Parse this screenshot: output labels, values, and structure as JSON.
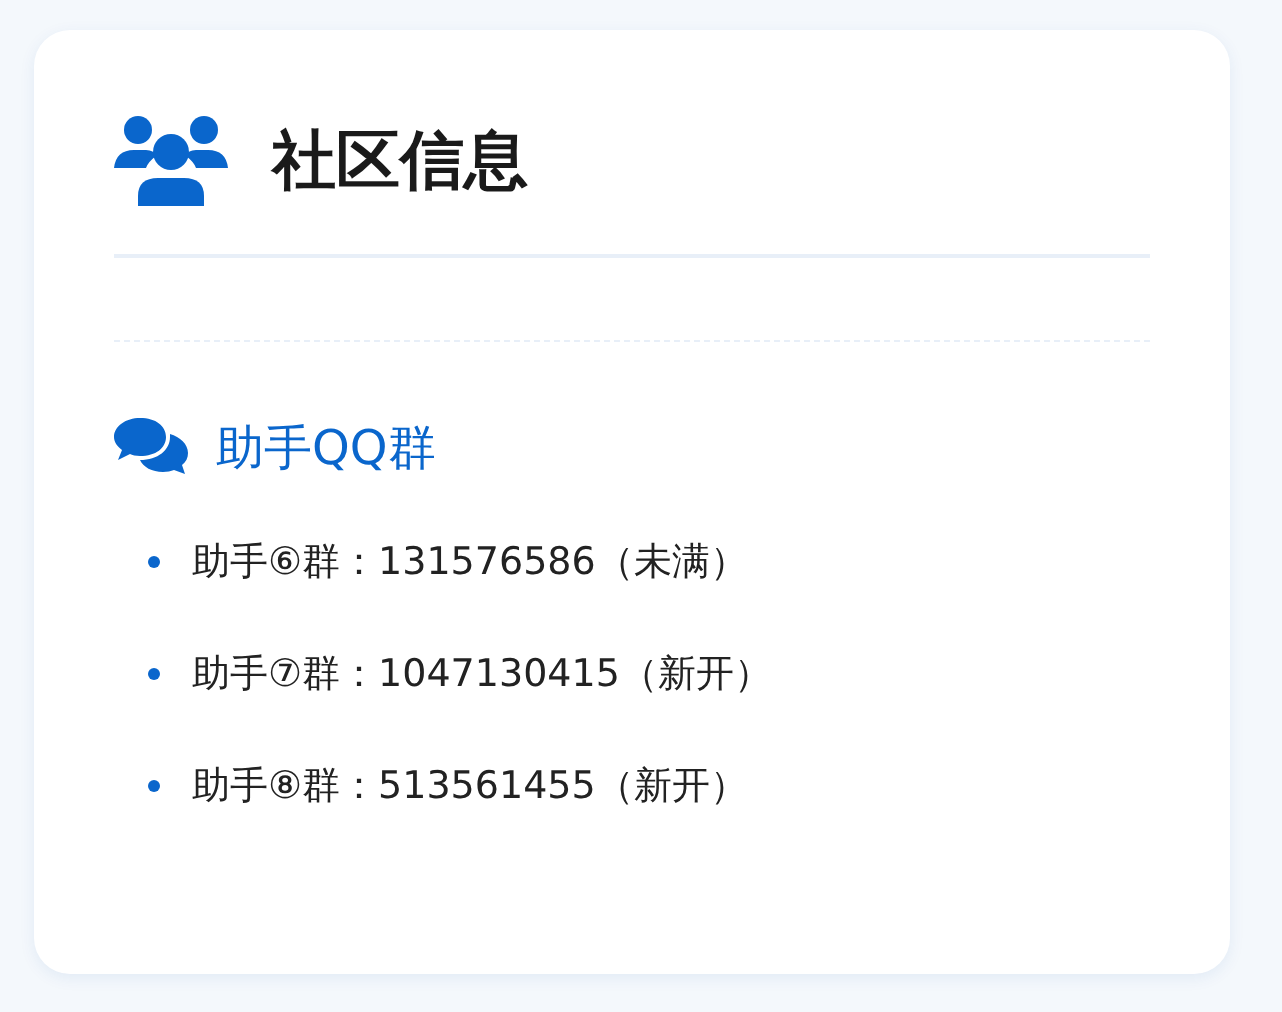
{
  "card": {
    "title": "社区信息"
  },
  "section": {
    "heading": "助手QQ群",
    "items": [
      "助手⑥群：131576586（未满）",
      "助手⑦群：1047130415（新开）",
      "助手⑧群：513561455（新开）"
    ]
  }
}
